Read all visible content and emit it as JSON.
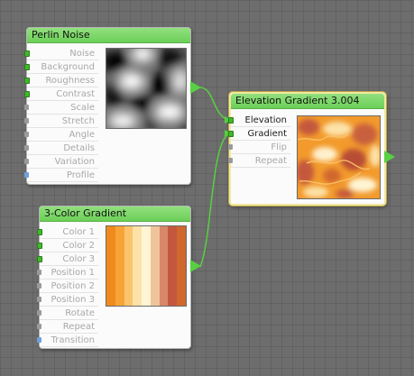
{
  "nodes": {
    "perlin": {
      "title": "Perlin Noise",
      "ports": [
        "Noise",
        "Background",
        "Roughness",
        "Contrast",
        "Scale",
        "Stretch",
        "Angle",
        "Details",
        "Variation",
        "Profile"
      ]
    },
    "gradient3": {
      "title": "3-Color Gradient",
      "ports": [
        "Color 1",
        "Color 2",
        "Color 3",
        "Position 1",
        "Position 2",
        "Position 3",
        "Rotate",
        "Repeat",
        "Transition"
      ],
      "stripe_colors": [
        "#f08a1c",
        "#f7a437",
        "#fbc46c",
        "#fde2a8",
        "#fff4d4",
        "#f0c49a",
        "#d8876a",
        "#c4583e",
        "#d0672e"
      ]
    },
    "elevation": {
      "title": "Elevation Gradient 3.004",
      "ports": [
        "Elevation",
        "Gradient",
        "Flip",
        "Repeat"
      ]
    }
  },
  "colors": {
    "wire": "#59cf43",
    "header": "#7ed46a",
    "pin_connected": "#42b82c"
  }
}
